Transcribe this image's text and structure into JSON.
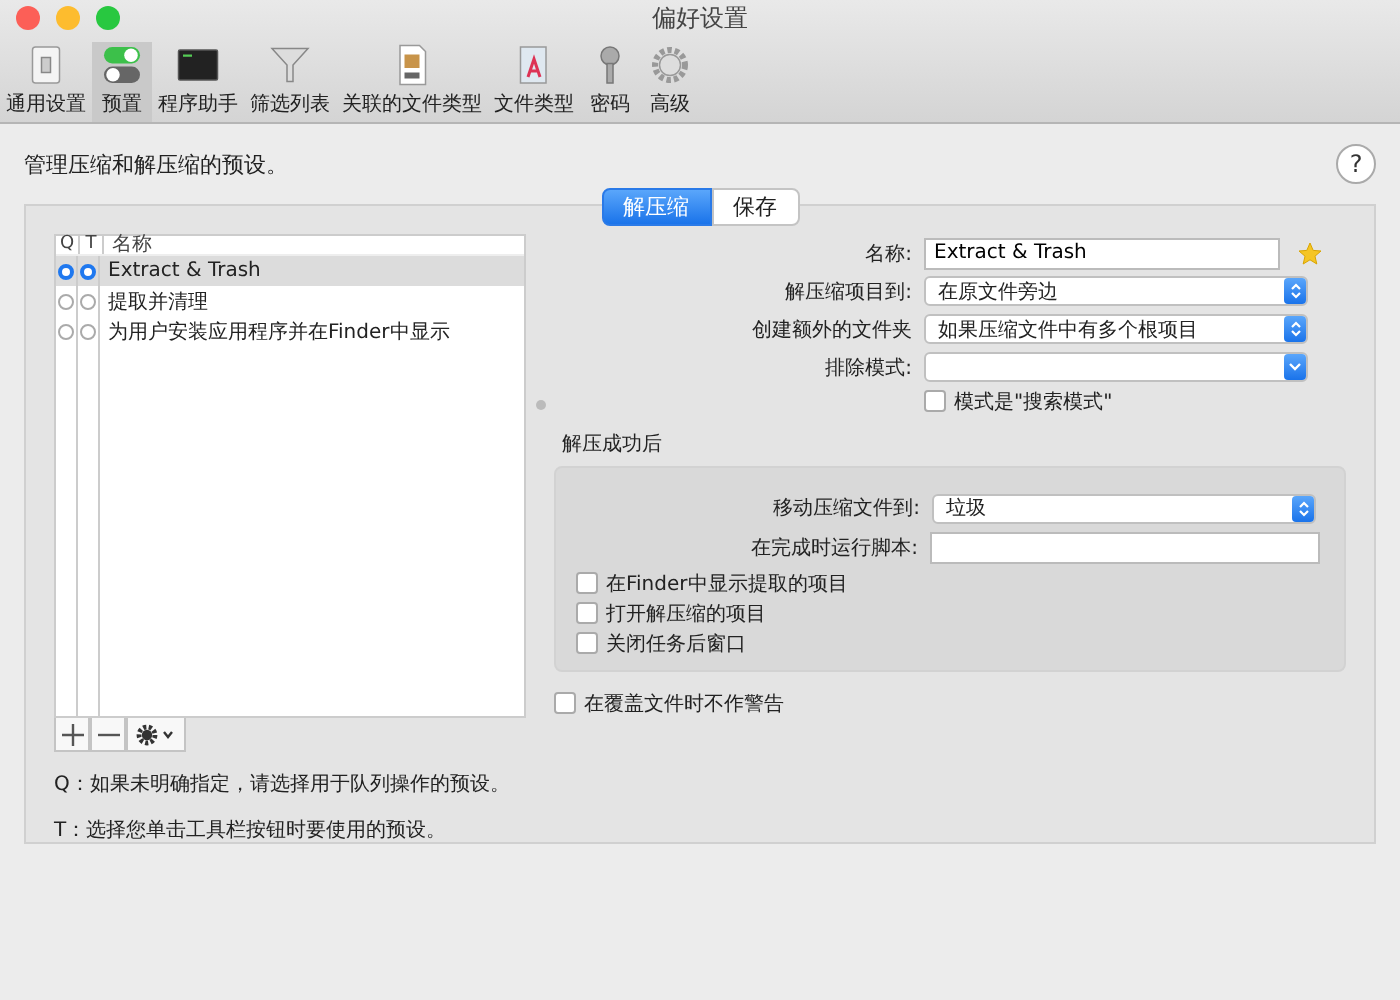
{
  "window": {
    "title": "偏好设置"
  },
  "toolbar": {
    "items": [
      {
        "label": "通用设置",
        "selected": false
      },
      {
        "label": "预置",
        "selected": true
      },
      {
        "label": "程序助手",
        "selected": false
      },
      {
        "label": "筛选列表",
        "selected": false
      },
      {
        "label": "关联的文件类型",
        "selected": false
      },
      {
        "label": "文件类型",
        "selected": false
      },
      {
        "label": "密码",
        "selected": false
      },
      {
        "label": "高级",
        "selected": false
      }
    ]
  },
  "description": "管理压缩和解压缩的预设。",
  "help": "?",
  "tabs": [
    {
      "label": "解压缩",
      "selected": true
    },
    {
      "label": "保存",
      "selected": false
    }
  ],
  "presets": {
    "columns": [
      "Q",
      "T",
      "名称"
    ],
    "rows": [
      {
        "name": "Extract & Trash",
        "q": true,
        "t": true,
        "selected": true
      },
      {
        "name": "提取并清理",
        "q": false,
        "t": false,
        "selected": false
      },
      {
        "name": "为用户安装应用程序并在Finder中显示",
        "q": false,
        "t": false,
        "selected": false
      }
    ]
  },
  "notes": [
    "Q：如果未明确指定，请选择用于队列操作的预设。",
    "T：选择您单击工具栏按钮时要使用的预设。"
  ],
  "form": {
    "fields": [
      {
        "kind": "text",
        "label": "名称:",
        "value": "Extract & Trash",
        "starred": true
      },
      {
        "kind": "popup",
        "label": "解压缩项目到:",
        "value": "在原文件旁边"
      },
      {
        "kind": "popup",
        "label": "创建额外的文件夹",
        "value": "如果压缩文件中有多个根项目"
      },
      {
        "kind": "combo",
        "label": "排除模式:"
      }
    ],
    "pattern_checkbox": {
      "label": "模式是\"搜索模式\"",
      "checked": false
    }
  },
  "after_success": {
    "title": "解压成功后",
    "fields": [
      {
        "kind": "popup",
        "label": "移动压缩文件到:",
        "value": "垃圾"
      },
      {
        "kind": "text",
        "label": "在完成时运行脚本:"
      }
    ],
    "checkboxes": [
      {
        "label": "在Finder中显示提取的项目",
        "checked": false
      },
      {
        "label": "打开解压缩的项目",
        "checked": false
      },
      {
        "label": "关闭任务后窗口",
        "checked": false
      }
    ]
  },
  "overwrite_checkbox": {
    "label": "在覆盖文件时不作警告",
    "checked": false
  }
}
